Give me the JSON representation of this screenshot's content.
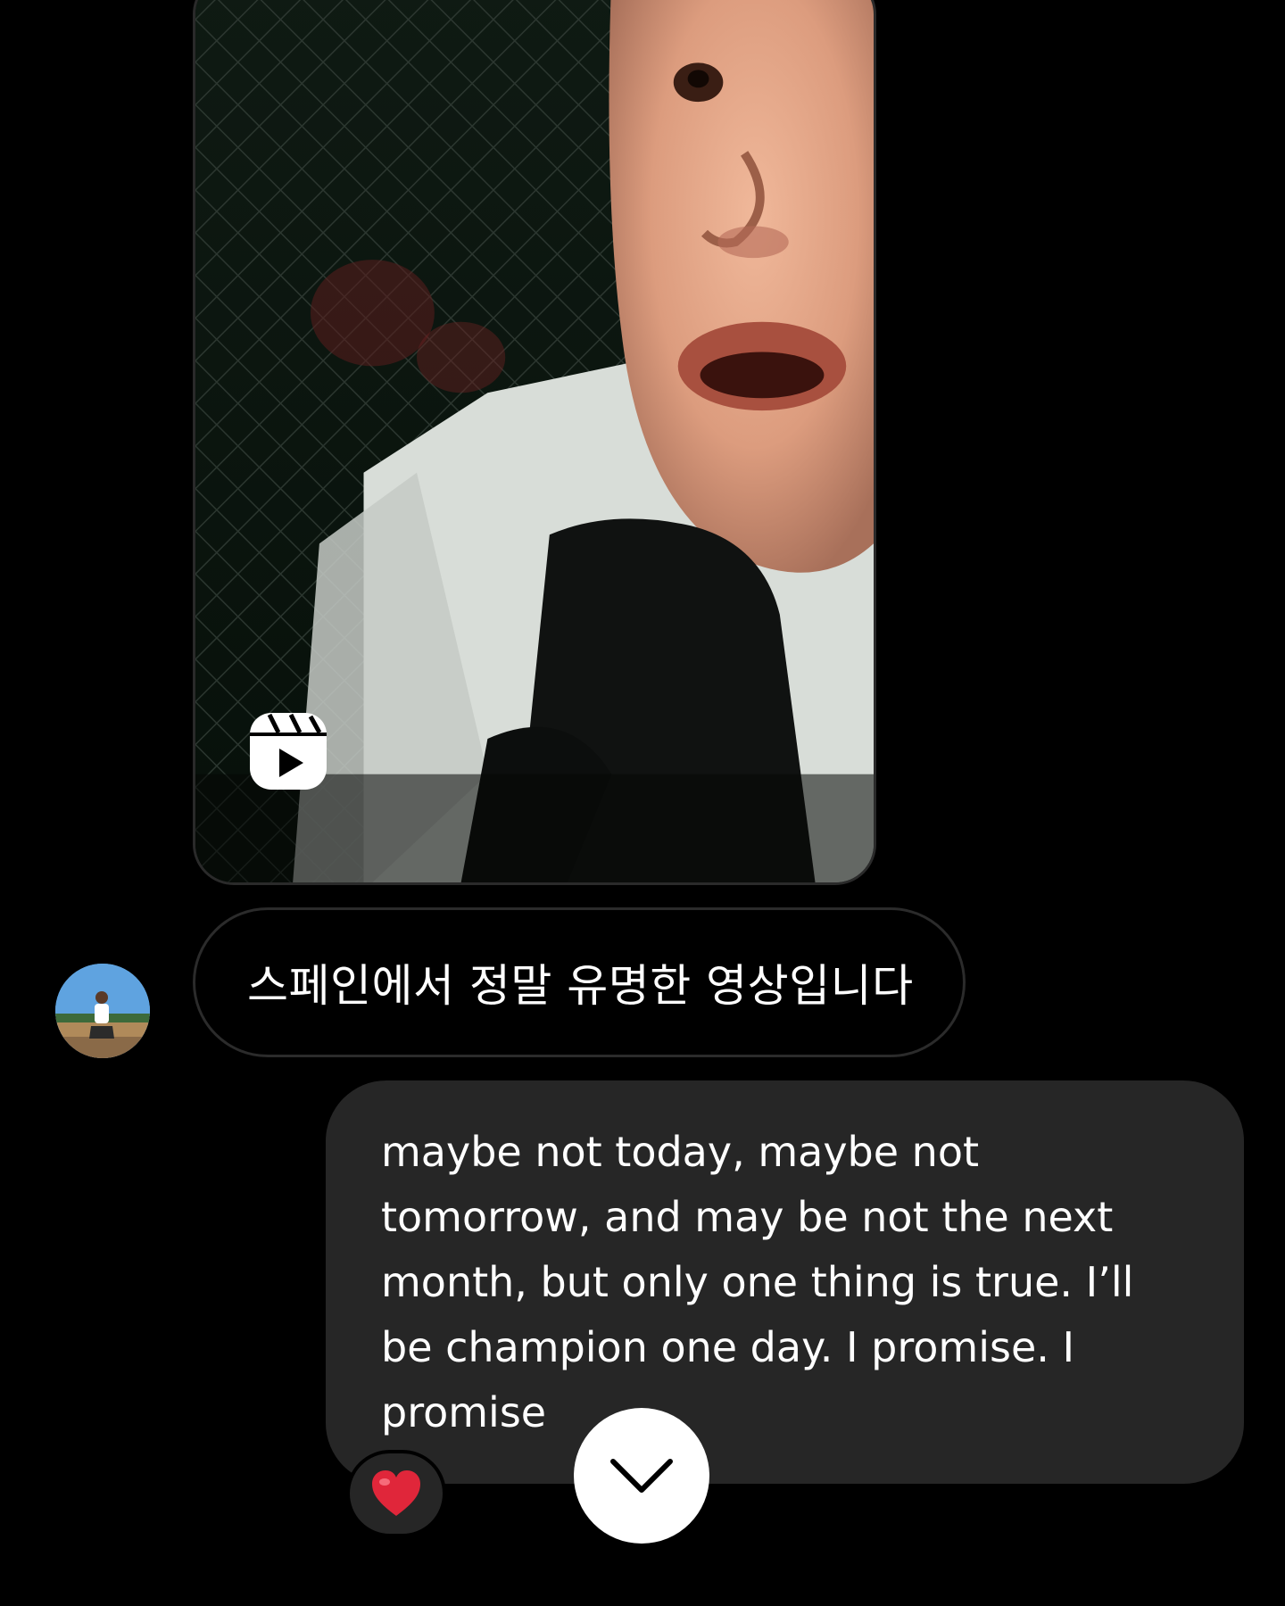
{
  "thread": {
    "shared_reel": {
      "icon": "reels-icon"
    },
    "incoming_message": {
      "text": "스페인에서 정말 유명한 영상입니다",
      "avatar": "avatar"
    },
    "outgoing_message": {
      "text": "maybe not today, maybe not\ntomorrow, and may be not the next\nmonth, but only one thing is true. I’ll\nbe champion one day. I promise. I\npromise",
      "reaction": "❤️"
    }
  },
  "controls": {
    "scroll_down_icon": "chevron-down-icon"
  },
  "colors": {
    "background": "#000000",
    "outgoing_bubble": "#262626",
    "incoming_border": "#2b2b2b",
    "heart": "#e0263a"
  }
}
